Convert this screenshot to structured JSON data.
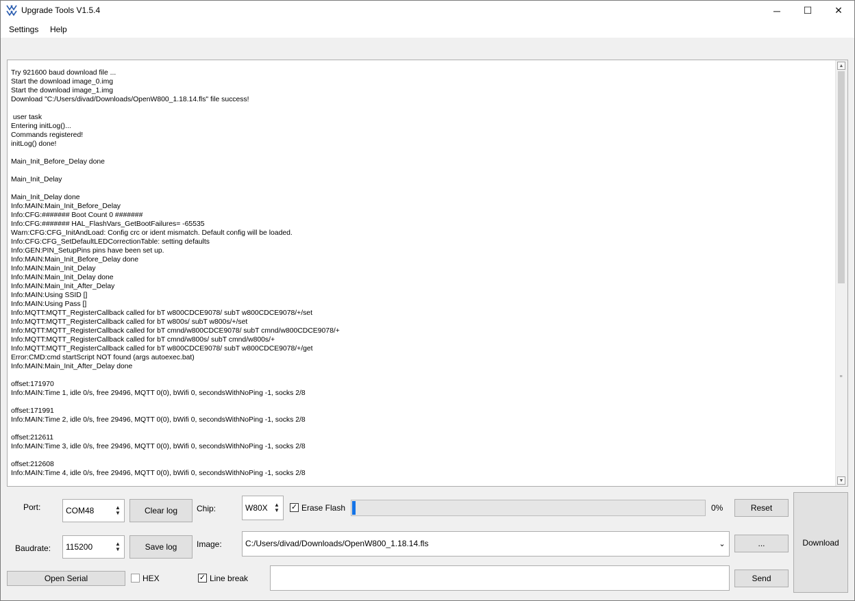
{
  "window": {
    "title": "Upgrade Tools V1.5.4",
    "controls": {
      "minimize": "─",
      "maximize": "☐",
      "close": "✕"
    }
  },
  "menu": {
    "items": [
      "Settings",
      "Help"
    ]
  },
  "log": {
    "lines": [
      "Try 921600 baud download file ...",
      "Start the download image_0.img",
      "Start the download image_1.img",
      "Download \"C:/Users/divad/Downloads/OpenW800_1.18.14.fls\" file success!",
      "",
      " user task",
      "Entering initLog()...",
      "Commands registered!",
      "initLog() done!",
      "",
      "Main_Init_Before_Delay done",
      "",
      "Main_Init_Delay",
      "",
      "Main_Init_Delay done",
      "Info:MAIN:Main_Init_Before_Delay",
      "Info:CFG:####### Boot Count 0 #######",
      "Info:CFG:####### HAL_FlashVars_GetBootFailures= -65535",
      "Warn:CFG:CFG_InitAndLoad: Config crc or ident mismatch. Default config will be loaded.",
      "Info:CFG:CFG_SetDefaultLEDCorrectionTable: setting defaults",
      "Info:GEN:PIN_SetupPins pins have been set up.",
      "Info:MAIN:Main_Init_Before_Delay done",
      "Info:MAIN:Main_Init_Delay",
      "Info:MAIN:Main_Init_Delay done",
      "Info:MAIN:Main_Init_After_Delay",
      "Info:MAIN:Using SSID []",
      "Info:MAIN:Using Pass []",
      "Info:MQTT:MQTT_RegisterCallback called for bT w800CDCE9078/ subT w800CDCE9078/+/set",
      "Info:MQTT:MQTT_RegisterCallback called for bT w800s/ subT w800s/+/set",
      "Info:MQTT:MQTT_RegisterCallback called for bT cmnd/w800CDCE9078/ subT cmnd/w800CDCE9078/+",
      "Info:MQTT:MQTT_RegisterCallback called for bT cmnd/w800s/ subT cmnd/w800s/+",
      "Info:MQTT:MQTT_RegisterCallback called for bT w800CDCE9078/ subT w800CDCE9078/+/get",
      "Error:CMD:cmd startScript NOT found (args autoexec.bat)",
      "Info:MAIN:Main_Init_After_Delay done",
      "",
      "offset:171970",
      "Info:MAIN:Time 1, idle 0/s, free 29496, MQTT 0(0), bWifi 0, secondsWithNoPing -1, socks 2/8",
      "",
      "offset:171991",
      "Info:MAIN:Time 2, idle 0/s, free 29496, MQTT 0(0), bWifi 0, secondsWithNoPing -1, socks 2/8",
      "",
      "offset:212611",
      "Info:MAIN:Time 3, idle 0/s, free 29496, MQTT 0(0), bWifi 0, secondsWithNoPing -1, socks 2/8",
      "",
      "offset:212608",
      "Info:MAIN:Time 4, idle 0/s, free 29496, MQTT 0(0), bWifi 0, secondsWithNoPing -1, socks 2/8"
    ]
  },
  "controls": {
    "port_label": "Port:",
    "port_value": "COM48",
    "clear_log": "Clear log",
    "chip_label": "Chip:",
    "chip_value": "W80X",
    "erase_flash_label": "Erase Flash",
    "erase_flash_checked": true,
    "progress_fraction": 0,
    "progress_text": "0%",
    "reset": "Reset",
    "baudrate_label": "Baudrate:",
    "baudrate_value": "115200",
    "save_log": "Save log",
    "image_label": "Image:",
    "image_value": "C:/Users/divad/Downloads/OpenW800_1.18.14.fls",
    "browse": "...",
    "download": "Download",
    "open_serial": "Open Serial",
    "hex_label": "HEX",
    "hex_checked": false,
    "line_break_label": "Line break",
    "line_break_checked": true,
    "send_value": "",
    "send": "Send"
  },
  "colors": {
    "progress_fill": "#06b025",
    "progress_lead": "#1473e6"
  }
}
